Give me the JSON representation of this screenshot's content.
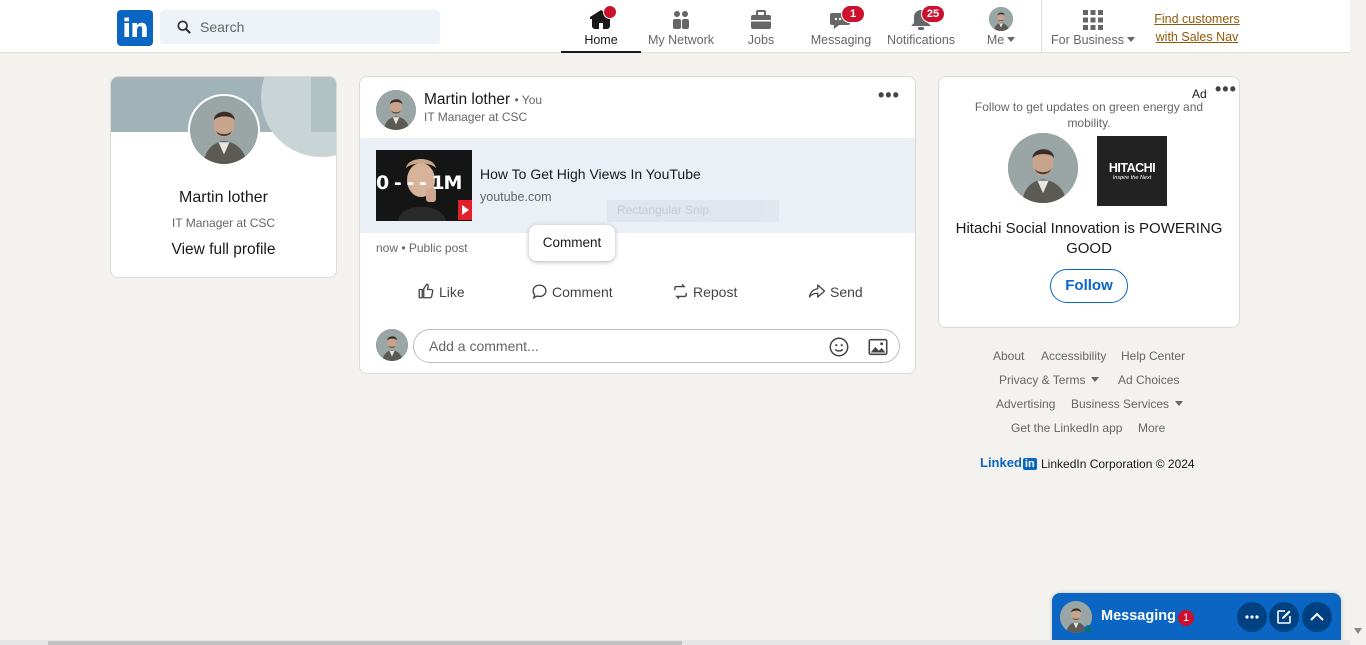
{
  "nav": {
    "logo": "in",
    "search_placeholder": "Search",
    "items": [
      {
        "label": "Home",
        "badge": ""
      },
      {
        "label": "My Network",
        "badge": ""
      },
      {
        "label": "Jobs",
        "badge": ""
      },
      {
        "label": "Messaging",
        "badge": "1"
      },
      {
        "label": "Notifications",
        "badge": "25"
      },
      {
        "label": "Me",
        "badge": ""
      },
      {
        "label": "For Business",
        "badge": ""
      }
    ],
    "sales_line1": "Find customers",
    "sales_line2": "with Sales Nav"
  },
  "profile": {
    "name": "Martin lother",
    "headline": "IT Manager at CSC",
    "link": "View full profile"
  },
  "post": {
    "author": "Martin lother",
    "you": "• You",
    "headline": "IT Manager at CSC",
    "link_title": "How To Get High Views In YouTube",
    "link_url": "youtube.com",
    "thumb_text": "0 - - - 1M",
    "ghost_text": "Rectangular Snip",
    "tooltip": "Comment",
    "meta": "now • Public post",
    "actions": {
      "like": "Like",
      "comment": "Comment",
      "repost": "Repost",
      "send": "Send"
    },
    "comment_placeholder": "Add a comment..."
  },
  "ad": {
    "label": "Ad",
    "text": "Follow to get updates on green energy and mobility.",
    "brand": "HITACHI",
    "brand_tag": "Inspire the Next",
    "headline": "Hitachi Social Innovation is POWERING GOOD",
    "follow": "Follow"
  },
  "footer": {
    "links_row1": [
      "About",
      "Accessibility",
      "Help Center"
    ],
    "privacy": "Privacy & Terms",
    "ad_choices": "Ad Choices",
    "advertising": "Advertising",
    "business": "Business Services",
    "app": "Get the LinkedIn app",
    "more": "More",
    "logo_text": "Linked",
    "logo_in": "in",
    "copyright": "LinkedIn Corporation © 2024"
  },
  "messaging": {
    "label": "Messaging",
    "badge": "1"
  },
  "colors": {
    "brand": "#0a66c2",
    "badge": "#cb112d",
    "background": "#f3f2ef"
  }
}
